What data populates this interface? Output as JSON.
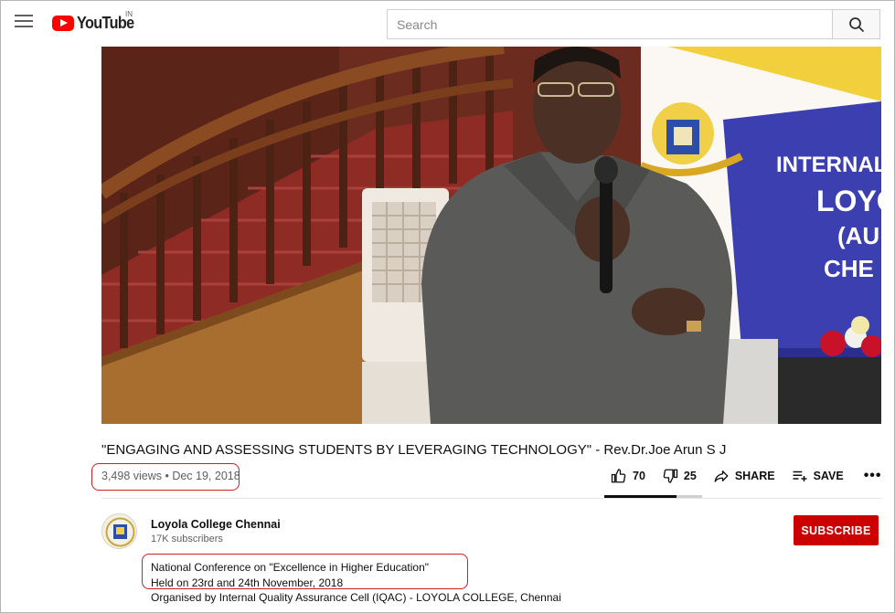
{
  "header": {
    "logo_text": "YouTube",
    "region": "IN",
    "search_placeholder": "Search"
  },
  "video": {
    "title": "\"ENGAGING AND ASSESSING STUDENTS BY LEVERAGING TECHNOLOGY\" - Rev.Dr.Joe Arun S J",
    "meta": "3,498 views • Dec 19, 2018",
    "banner_text": [
      "INTERNAL QUA",
      "LOYO",
      "(AU",
      "CHE"
    ]
  },
  "actions": {
    "likes": "70",
    "dislikes": "25",
    "share_label": "SHARE",
    "save_label": "SAVE",
    "more_label": "•••",
    "like_ratio": 0.74
  },
  "channel": {
    "name": "Loyola College Chennai",
    "subscribers": "17K subscribers",
    "subscribe_label": "SUBSCRIBE"
  },
  "description": {
    "line1": "National Conference on \"Excellence in Higher Education\"",
    "line2": "Held on 23rd and 24th November, 2018",
    "line3": "Organised by Internal Quality Assurance Cell (IQAC) - LOYOLA COLLEGE, Chennai"
  },
  "colors": {
    "brand_red": "#ff0000",
    "subscribe_red": "#cc0000",
    "highlight_red": "#d01f1f"
  }
}
